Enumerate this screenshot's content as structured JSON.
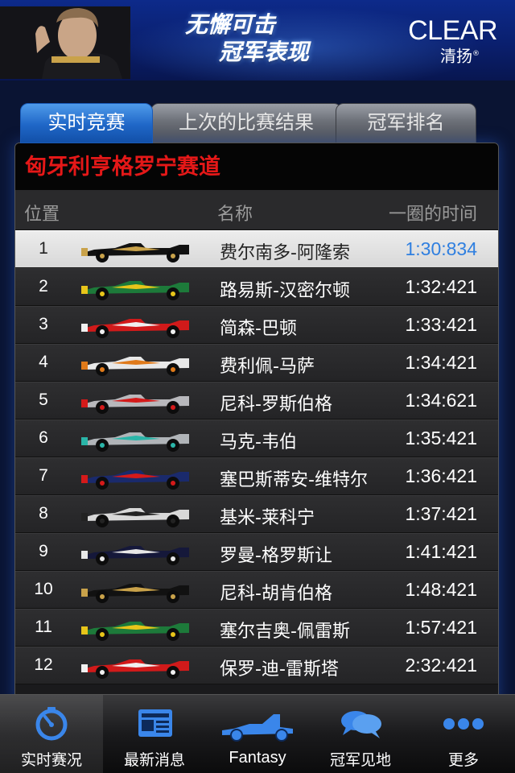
{
  "banner": {
    "slogan_line1": "无懈可击",
    "slogan_line2": "冠军表现",
    "brand_name": "CLEAR",
    "brand_sub": "清扬",
    "brand_mark": "®"
  },
  "tabs": [
    {
      "label": "实时竞赛",
      "active": true
    },
    {
      "label": "上次的比赛结果",
      "active": false
    },
    {
      "label": "冠军排名",
      "active": false
    }
  ],
  "race": {
    "track_name": "匈牙利亨格罗宁赛道",
    "columns": {
      "position": "位置",
      "name": "名称",
      "lap_time": "一圈的时间"
    },
    "rows": [
      {
        "pos": "1",
        "name": "费尔南多-阿隆索",
        "time": "1:30:834",
        "car_icon": "lotus-car-icon"
      },
      {
        "pos": "2",
        "name": "路易斯-汉密尔顿",
        "time": "1:32:421",
        "car_icon": "caterham-car-icon"
      },
      {
        "pos": "3",
        "name": "简森-巴顿",
        "time": "1:33:421",
        "car_icon": "ferrari-car-icon"
      },
      {
        "pos": "4",
        "name": "费利佩-马萨",
        "time": "1:34:421",
        "car_icon": "force-india-car-icon"
      },
      {
        "pos": "5",
        "name": "尼科-罗斯伯格",
        "time": "1:34:621",
        "car_icon": "mclaren-car-icon"
      },
      {
        "pos": "6",
        "name": "马克-韦伯",
        "time": "1:35:421",
        "car_icon": "mercedes-car-icon"
      },
      {
        "pos": "7",
        "name": "塞巴斯蒂安-维特尔",
        "time": "1:36:421",
        "car_icon": "red-bull-car-icon"
      },
      {
        "pos": "8",
        "name": "基米-莱科宁",
        "time": "1:37:421",
        "car_icon": "sauber-car-icon"
      },
      {
        "pos": "9",
        "name": "罗曼-格罗斯让",
        "time": "1:41:421",
        "car_icon": "williams-car-icon"
      },
      {
        "pos": "10",
        "name": "尼科-胡肯伯格",
        "time": "1:48:421",
        "car_icon": "lotus-car-icon"
      },
      {
        "pos": "11",
        "name": "塞尔吉奥-佩雷斯",
        "time": "1:57:421",
        "car_icon": "caterham-car-icon"
      },
      {
        "pos": "12",
        "name": "保罗-迪-雷斯塔",
        "time": "2:32:421",
        "car_icon": "ferrari-car-icon"
      }
    ]
  },
  "bottom_nav": [
    {
      "label": "实时赛况",
      "icon": "stopwatch-icon",
      "active": true
    },
    {
      "label": "最新消息",
      "icon": "newspaper-icon",
      "active": false
    },
    {
      "label": "Fantasy",
      "icon": "race-car-icon",
      "active": false
    },
    {
      "label": "冠军见地",
      "icon": "chat-bubbles-icon",
      "active": false
    },
    {
      "label": "更多",
      "icon": "more-dots-icon",
      "active": false
    }
  ],
  "colors": {
    "accent_blue": "#2f7fe0",
    "track_title_red": "#e51818",
    "banner_blue": "#0d2a8a"
  }
}
